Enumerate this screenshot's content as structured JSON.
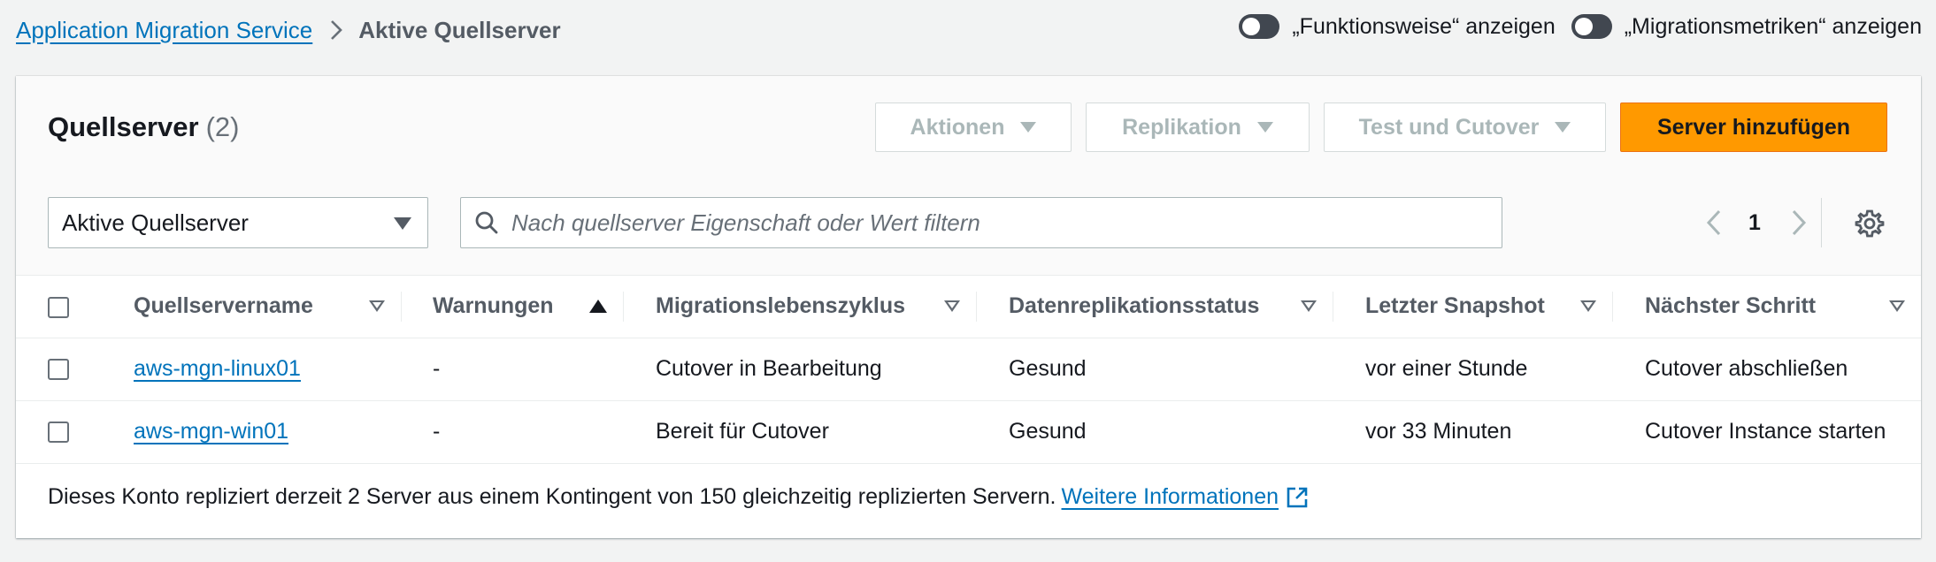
{
  "breadcrumb": {
    "root": "Application Migration Service",
    "current": "Aktive Quellserver"
  },
  "toggles": {
    "how_it_works": "„Funktionsweise“ anzeigen",
    "migration_metrics": "„Migrationsmetriken“ anzeigen"
  },
  "header": {
    "title": "Quellserver",
    "count": "(2)"
  },
  "buttons": {
    "actions": "Aktionen",
    "replication": "Replikation",
    "test_cutover": "Test und Cutover",
    "add_server": "Server hinzufügen"
  },
  "filter": {
    "select_value": "Aktive Quellserver",
    "search_placeholder": "Nach quellserver Eigenschaft oder Wert filtern"
  },
  "pagination": {
    "current_page": "1"
  },
  "table": {
    "columns": [
      "Quellservername",
      "Warnungen",
      "Migrationslebenszyklus",
      "Datenreplikationsstatus",
      "Letzter Snapshot",
      "Nächster Schritt"
    ],
    "rows": [
      {
        "name": "aws-mgn-linux01",
        "warnings": "-",
        "lifecycle": "Cutover in Bearbeitung",
        "replication": "Gesund",
        "snapshot": "vor einer Stunde",
        "next_step": "Cutover abschließen"
      },
      {
        "name": "aws-mgn-win01",
        "warnings": "-",
        "lifecycle": "Bereit für Cutover",
        "replication": "Gesund",
        "snapshot": "vor 33 Minuten",
        "next_step": "Cutover Instance starten"
      }
    ]
  },
  "footer": {
    "text": "Dieses Konto repliziert derzeit 2 Server aus einem Kontingent von 150 gleichzeitig replizierten Servern.",
    "link": "Weitere Informationen"
  },
  "colors": {
    "link": "#0073bb",
    "primary": "#ff9900",
    "text": "#16191f",
    "secondary_text": "#545b64"
  }
}
